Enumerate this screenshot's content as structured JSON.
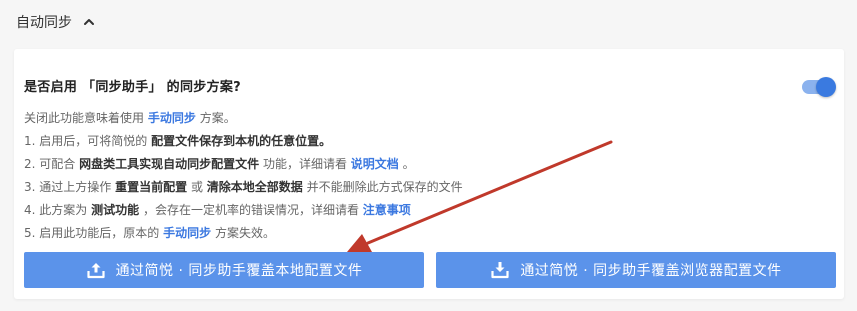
{
  "section": {
    "title": "自动同步"
  },
  "card": {
    "question": "是否启用 「同步助手」 的同步方案?",
    "toggle_on": true,
    "intro": {
      "pre": "关闭此功能意味着使用",
      "link": "手动同步",
      "post": "方案。"
    },
    "items": [
      {
        "pre": "1. 启用后，可将简悦的",
        "bold": "配置文件保存到本机的任意位置。"
      },
      {
        "pre": "2. 可配合",
        "bold": "网盘类工具实现自动同步配置文件",
        "mid": "功能，详细请看",
        "link": "说明文档",
        "post": "。"
      },
      {
        "pre": "3. 通过上方操作",
        "bold": "重置当前配置",
        "mid": "或",
        "bold2": "清除本地全部数据",
        "post": "并不能删除此方式保存的文件"
      },
      {
        "pre": "4. 此方案为",
        "bold": "测试功能",
        "mid": "，会存在一定机率的错误情况，详细请看",
        "link": "注意事项"
      },
      {
        "pre": "5. 启用此功能后，原本的",
        "link": "手动同步",
        "post": "方案失效。"
      }
    ]
  },
  "buttons": {
    "upload": "通过简悦 · 同步助手覆盖本地配置文件",
    "download": "通过简悦 · 同步助手覆盖浏览器配置文件"
  },
  "icons": {
    "collapse": "chevron-up-icon",
    "upload": "upload-tray-icon",
    "download": "download-tray-icon"
  },
  "colors": {
    "accent": "#5b93ea",
    "link": "#3b78e0",
    "annotation_arrow": "#c0392b"
  }
}
